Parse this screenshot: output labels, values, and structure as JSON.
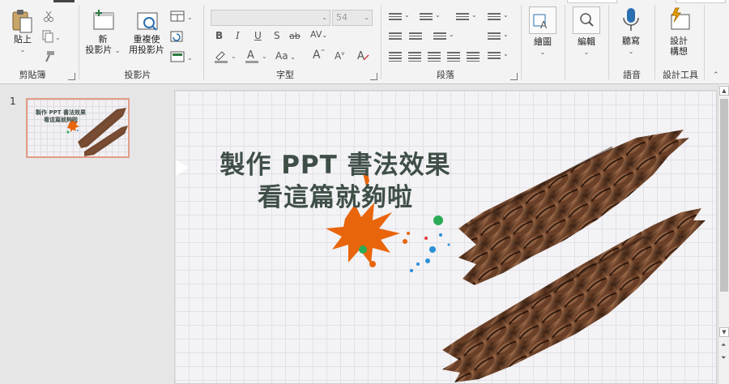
{
  "ribbon": {
    "clipboard": {
      "paste_label": "貼上",
      "group_label": "剪貼簿"
    },
    "slides": {
      "new_slide_line1": "新",
      "new_slide_line2": "投影片",
      "reuse_line1": "重複使",
      "reuse_line2": "用投影片",
      "group_label": "投影片"
    },
    "font": {
      "font_name": "",
      "font_size": "54",
      "group_label": "字型",
      "bold": "B",
      "italic": "I",
      "underline": "U",
      "shadow": "S",
      "strike": "ab",
      "spacing": "AV",
      "case": "Aa",
      "grow": "A",
      "shrink": "A"
    },
    "paragraph": {
      "group_label": "段落"
    },
    "drawing": {
      "label": "繪圖"
    },
    "editing": {
      "label": "編輯"
    },
    "voice": {
      "dictate_label": "聽寫",
      "group_label": "語音"
    },
    "designer": {
      "line1": "設計",
      "line2": "構想",
      "group_label": "設計工具"
    }
  },
  "thumbnails": {
    "slide_number": "1",
    "title_line1": "製作 PPT 書法效果",
    "title_line2": "看這篇就夠啦"
  },
  "slide": {
    "title_line1": "製作 PPT 書法效果",
    "title_line2": "看這篇就夠啦"
  },
  "colors": {
    "accent_orange": "#e8650c",
    "title_color": "#3f4f48",
    "thumb_border": "#e39d86",
    "coffee_dark": "#3b2418"
  }
}
